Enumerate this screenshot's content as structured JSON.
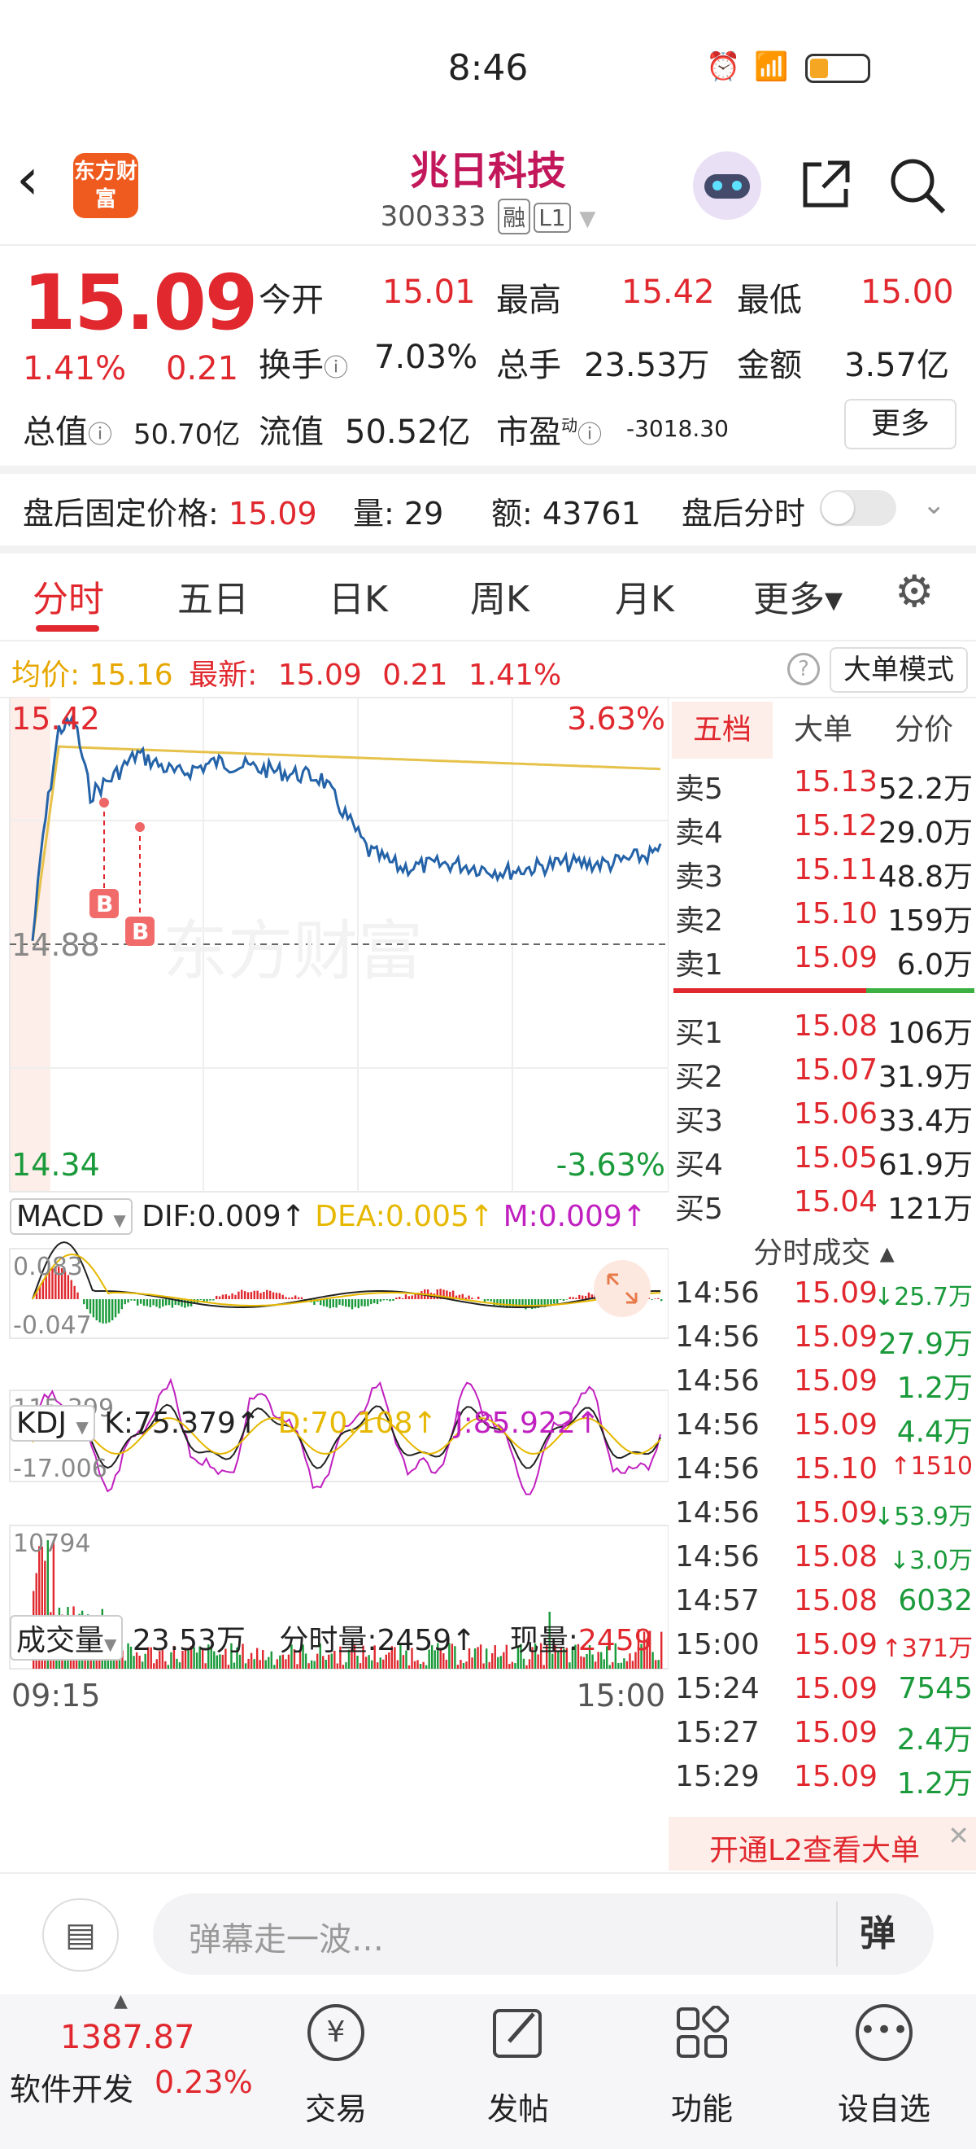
{
  "status": {
    "time": "8:46"
  },
  "header": {
    "title": "兆日科技",
    "code": "300333",
    "tags": [
      "融",
      "L1"
    ],
    "logo_text": "东方财富"
  },
  "quote": {
    "price": "15.09",
    "pct": "1.41%",
    "chg": "0.21",
    "open_label": "今开",
    "open": "15.01",
    "high_label": "最高",
    "high": "15.42",
    "low_label": "最低",
    "low": "15.00",
    "turnover_label": "换手",
    "turnover": "7.03%",
    "volume_label": "总手",
    "volume": "23.53万",
    "amount_label": "金额",
    "amount": "3.57亿",
    "mcap_label": "总值",
    "mcap": "50.70亿",
    "float_label": "流值",
    "float": "50.52亿",
    "pe_label": "市盈",
    "pe_sup": "动",
    "pe": "-3018.30",
    "more": "更多"
  },
  "after_hours": {
    "price_label": "盘后固定价格:",
    "price": "15.09",
    "vol_label": "量:",
    "vol": "29",
    "amt_label": "额:",
    "amt": "43761",
    "switch_label": "盘后分时"
  },
  "tabs": [
    "分时",
    "五日",
    "日K",
    "周K",
    "月K",
    "更多▾"
  ],
  "info": {
    "avg_label": "均价:",
    "avg": "15.16",
    "latest_label": "最新:",
    "latest": "15.09",
    "chg": "0.21",
    "pct": "1.41%",
    "mode_button": "大单模式"
  },
  "price_axis": {
    "top": "15.42",
    "mid": "14.88",
    "bottom": "14.34",
    "top_pct": "3.63%",
    "bottom_pct": "-3.63%"
  },
  "watermark": "东方财富",
  "markers": [
    "B",
    "B"
  ],
  "macd": {
    "name": "MACD",
    "dif": "DIF:0.009↑",
    "dea": "DEA:0.005↑",
    "m": "M:0.009↑",
    "top": "0.083",
    "bottom": "-0.047"
  },
  "kdj": {
    "name": "KDJ",
    "k": "K:75.379↑",
    "d": "D:70.108↑",
    "j": "J:85.922↑",
    "top": "115.399",
    "bottom": "-17.006"
  },
  "vol": {
    "name": "成交量",
    "total": "23.53万",
    "minute": "分时量:2459↑",
    "now_label": "现量:",
    "now": "2459",
    "top": "10794"
  },
  "time_axis": {
    "start": "09:15",
    "end": "15:00"
  },
  "orderbook": {
    "tabs": [
      "五档",
      "大单",
      "分价"
    ],
    "sells": [
      {
        "l": "卖5",
        "p": "15.13",
        "v": "52.2万"
      },
      {
        "l": "卖4",
        "p": "15.12",
        "v": "29.0万"
      },
      {
        "l": "卖3",
        "p": "15.11",
        "v": "48.8万"
      },
      {
        "l": "卖2",
        "p": "15.10",
        "v": "159万"
      },
      {
        "l": "卖1",
        "p": "15.09",
        "v": "6.0万"
      }
    ],
    "buys": [
      {
        "l": "买1",
        "p": "15.08",
        "v": "106万"
      },
      {
        "l": "买2",
        "p": "15.07",
        "v": "31.9万"
      },
      {
        "l": "买3",
        "p": "15.06",
        "v": "33.4万"
      },
      {
        "l": "买4",
        "p": "15.05",
        "v": "61.9万"
      },
      {
        "l": "买5",
        "p": "15.04",
        "v": "121万"
      }
    ],
    "trades_title": "分时成交 ▴",
    "trades": [
      {
        "t": "14:56",
        "p": "15.09",
        "v": "↓25.7万"
      },
      {
        "t": "14:56",
        "p": "15.09",
        "v": "27.9万"
      },
      {
        "t": "14:56",
        "p": "15.09",
        "v": "1.2万"
      },
      {
        "t": "14:56",
        "p": "15.09",
        "v": "4.4万"
      },
      {
        "t": "14:56",
        "p": "15.10",
        "v": "↑1510"
      },
      {
        "t": "14:56",
        "p": "15.09",
        "v": "↓53.9万"
      },
      {
        "t": "14:56",
        "p": "15.08",
        "v": "↓3.0万"
      },
      {
        "t": "14:57",
        "p": "15.08",
        "v": "6032"
      },
      {
        "t": "15:00",
        "p": "15.09",
        "v": "↑371万"
      },
      {
        "t": "15:24",
        "p": "15.09",
        "v": "7545"
      },
      {
        "t": "15:27",
        "p": "15.09",
        "v": "2.4万"
      },
      {
        "t": "15:29",
        "p": "15.09",
        "v": "1.2万"
      }
    ],
    "l2_banner": "开通L2查看大单"
  },
  "comment": {
    "placeholder": "弹幕走一波…",
    "danmu_btn": "弹"
  },
  "bottom_nav": {
    "index_value": "1387.87",
    "index_name": "软件开发",
    "index_pct": "0.23%",
    "items": [
      "交易",
      "发帖",
      "功能",
      "设自选"
    ]
  },
  "colors": {
    "up": "#e0282e",
    "down": "#1a9a3a",
    "price_line": "#2563a8",
    "avg_line": "#e6c24a",
    "dea": "#e6b800",
    "m": "#c020c0"
  }
}
